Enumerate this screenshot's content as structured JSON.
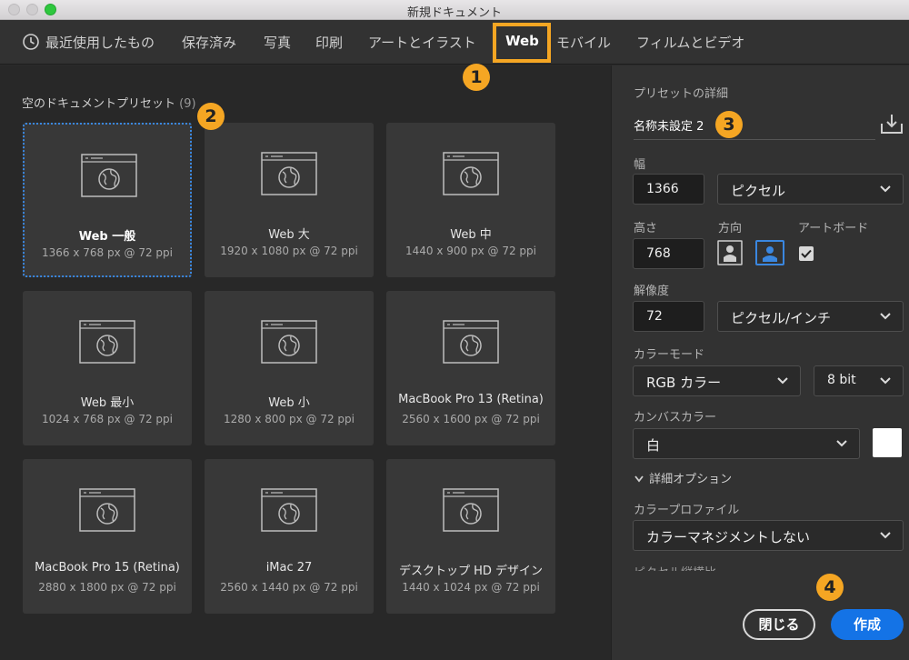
{
  "window": {
    "title": "新規ドキュメント"
  },
  "tabs": [
    {
      "label": "最近使用したもの"
    },
    {
      "label": "保存済み"
    },
    {
      "label": "写真"
    },
    {
      "label": "印刷"
    },
    {
      "label": "アートとイラスト"
    },
    {
      "label": "Web"
    },
    {
      "label": "モバイル"
    },
    {
      "label": "フィルムとビデオ"
    }
  ],
  "presets": {
    "title": "空のドキュメントプリセット",
    "count": "(9)",
    "items": [
      {
        "name": "Web 一般",
        "size": "1366 x 768 px @ 72 ppi"
      },
      {
        "name": "Web 大",
        "size": "1920 x 1080 px @ 72 ppi"
      },
      {
        "name": "Web 中",
        "size": "1440 x 900 px @ 72 ppi"
      },
      {
        "name": "Web 最小",
        "size": "1024 x 768 px @ 72 ppi"
      },
      {
        "name": "Web 小",
        "size": "1280 x 800 px @ 72 ppi"
      },
      {
        "name": "MacBook Pro 13 (Retina)",
        "size": "2560 x 1600 px @ 72 ppi"
      },
      {
        "name": "MacBook Pro 15 (Retina)",
        "size": "2880 x 1800 px @ 72 ppi"
      },
      {
        "name": "iMac 27",
        "size": "2560 x 1440 px @ 72 ppi"
      },
      {
        "name": "デスクトップ HD デザイン",
        "size": "1440 x 1024 px @ 72 ppi"
      }
    ]
  },
  "details": {
    "title": "プリセットの詳細",
    "doc_name": "名称未設定 2",
    "width_label": "幅",
    "width_value": "1366",
    "width_unit": "ピクセル",
    "height_label": "高さ",
    "height_value": "768",
    "orientation_label": "方向",
    "artboard_label": "アートボード",
    "resolution_label": "解像度",
    "resolution_value": "72",
    "resolution_unit": "ピクセル/インチ",
    "color_mode_label": "カラーモード",
    "color_mode_value": "RGB カラー",
    "bit_depth_value": "8 bit",
    "canvas_color_label": "カンバスカラー",
    "canvas_color_value": "白",
    "advanced_label": "詳細オプション",
    "profile_label": "カラープロファイル",
    "profile_value": "カラーマネジメントしない",
    "pixel_aspect_label": "ピクセル縦横比"
  },
  "buttons": {
    "close": "閉じる",
    "create": "作成"
  },
  "annotations": [
    "1",
    "2",
    "3",
    "4"
  ],
  "colors": {
    "accent": "#1473e6",
    "highlight": "#f5a623",
    "selection": "#3a87e0"
  }
}
